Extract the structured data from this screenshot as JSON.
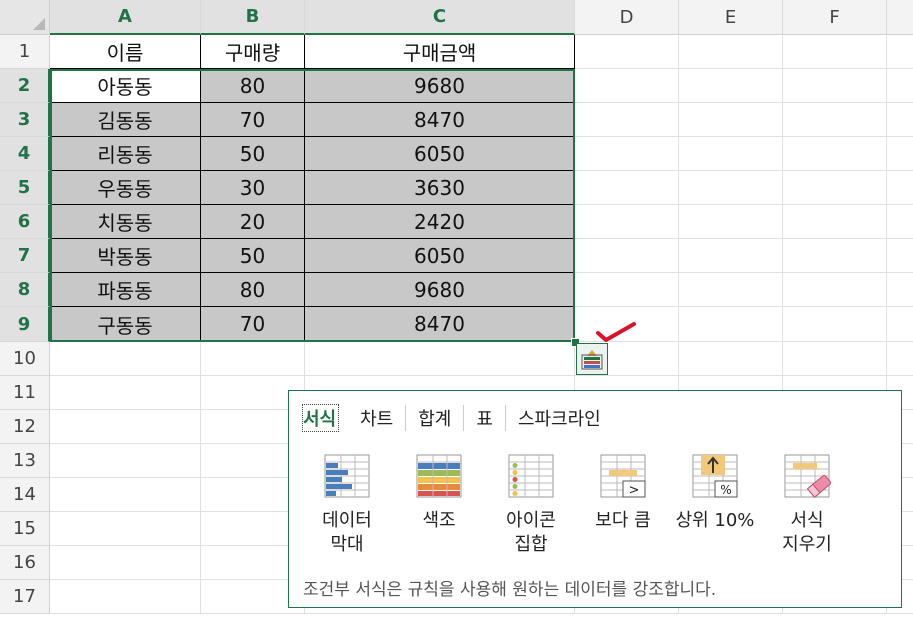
{
  "sheet": {
    "columns": [
      "A",
      "B",
      "C",
      "D",
      "E",
      "F"
    ],
    "rows": [
      "1",
      "2",
      "3",
      "4",
      "5",
      "6",
      "7",
      "8",
      "9",
      "10",
      "11",
      "12",
      "13",
      "14",
      "15",
      "16",
      "17"
    ],
    "table": {
      "header": [
        "이름",
        "구매량",
        "구매금액"
      ],
      "records": [
        [
          "아동동",
          "80",
          "9680"
        ],
        [
          "김동동",
          "70",
          "8470"
        ],
        [
          "리동동",
          "50",
          "6050"
        ],
        [
          "우동동",
          "30",
          "3630"
        ],
        [
          "치동동",
          "20",
          "2420"
        ],
        [
          "박동동",
          "50",
          "6050"
        ],
        [
          "파동동",
          "80",
          "9680"
        ],
        [
          "구동동",
          "70",
          "8470"
        ]
      ]
    }
  },
  "quick_analysis": {
    "tabs": [
      "서식",
      "차트",
      "합계",
      "표",
      "스파크라인"
    ],
    "active_tab": "서식",
    "options": [
      {
        "label1": "데이터",
        "label2": "막대",
        "icon": "data-bars-icon"
      },
      {
        "label1": "색조",
        "label2": "",
        "icon": "color-scale-icon"
      },
      {
        "label1": "아이콘",
        "label2": "집합",
        "icon": "icon-set-icon"
      },
      {
        "label1": "보다 큼",
        "label2": "",
        "icon": "greater-than-icon"
      },
      {
        "label1": "상위 10%",
        "label2": "",
        "icon": "top-ten-percent-icon"
      },
      {
        "label1": "서식",
        "label2": "지우기",
        "icon": "clear-format-icon"
      }
    ],
    "description": "조건부 서식은 규칙을 사용해 원하는 데이터를 강조합니다."
  },
  "colors": {
    "accent": "#217346",
    "check": "#d9132a",
    "shade": "#c8c8c8"
  }
}
